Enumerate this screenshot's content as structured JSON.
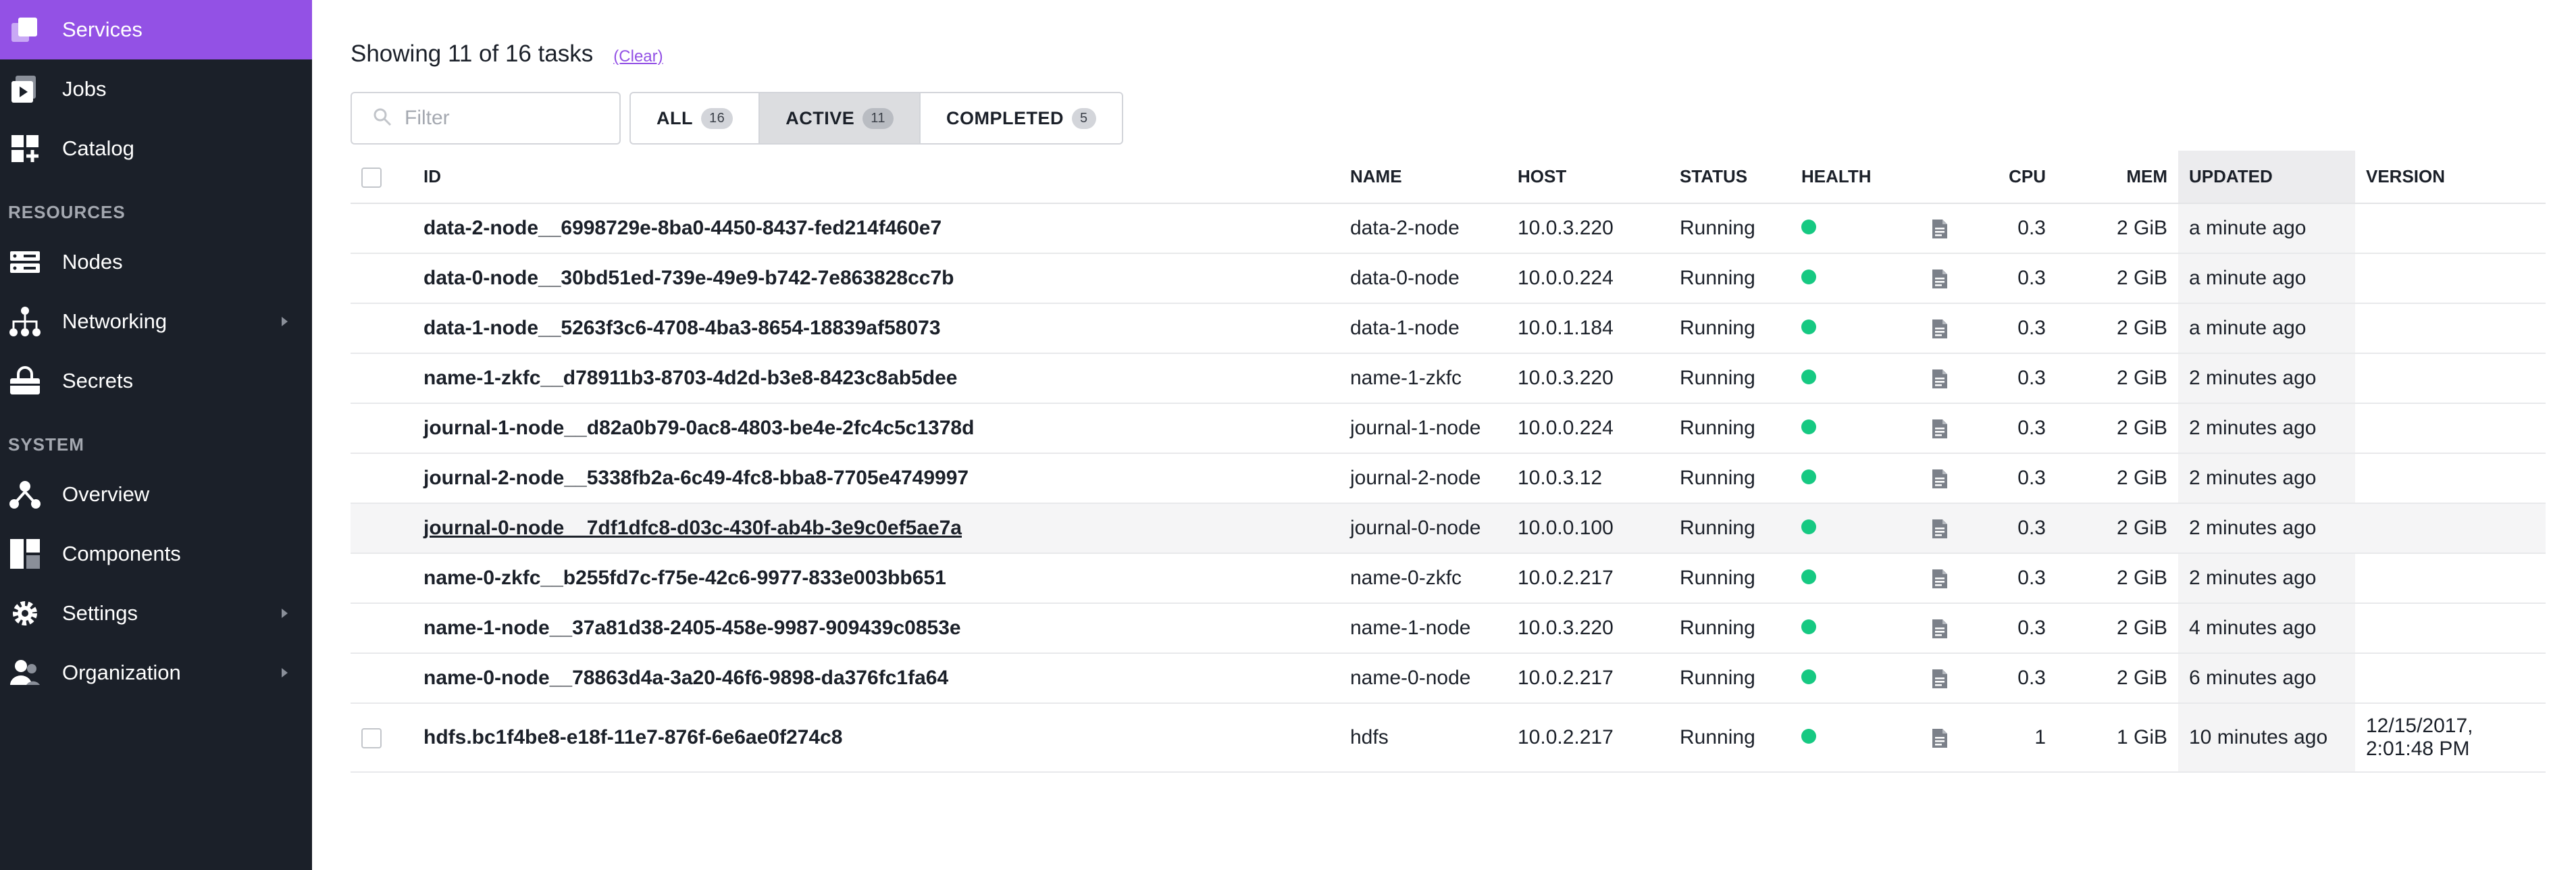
{
  "sidebar": {
    "primary": [
      {
        "label": "Services",
        "icon": "services-icon",
        "active": true
      },
      {
        "label": "Jobs",
        "icon": "jobs-icon"
      },
      {
        "label": "Catalog",
        "icon": "catalog-icon"
      }
    ],
    "resources_label": "RESOURCES",
    "resources": [
      {
        "label": "Nodes",
        "icon": "nodes-icon"
      },
      {
        "label": "Networking",
        "icon": "networking-icon"
      },
      {
        "label": "Secrets",
        "icon": "secrets-icon"
      }
    ],
    "system_label": "SYSTEM",
    "system": [
      {
        "label": "Overview",
        "icon": "overview-icon"
      },
      {
        "label": "Components",
        "icon": "components-icon"
      },
      {
        "label": "Settings",
        "icon": "gear-icon"
      },
      {
        "label": "Organization",
        "icon": "organization-icon"
      }
    ]
  },
  "header": {
    "showing": "Showing 11 of 16 tasks",
    "clear": "(Clear)"
  },
  "filter": {
    "placeholder": "Filter",
    "value": ""
  },
  "tabs": [
    {
      "label": "ALL",
      "count": "16"
    },
    {
      "label": "ACTIVE",
      "count": "11",
      "selected": true
    },
    {
      "label": "COMPLETED",
      "count": "5"
    }
  ],
  "table": {
    "columns": {
      "id": "ID",
      "name": "NAME",
      "host": "HOST",
      "status": "STATUS",
      "health": "HEALTH",
      "cpu": "CPU",
      "mem": "MEM",
      "updated": "UPDATED",
      "version": "VERSION"
    },
    "rows": [
      {
        "id": "data-2-node__6998729e-8ba0-4450-8437-fed214f460e7",
        "name": "data-2-node",
        "host": "10.0.3.220",
        "status": "Running",
        "cpu": "0.3",
        "mem": "2 GiB",
        "updated": "a minute ago",
        "version": ""
      },
      {
        "id": "data-0-node__30bd51ed-739e-49e9-b742-7e863828cc7b",
        "name": "data-0-node",
        "host": "10.0.0.224",
        "status": "Running",
        "cpu": "0.3",
        "mem": "2 GiB",
        "updated": "a minute ago",
        "version": ""
      },
      {
        "id": "data-1-node__5263f3c6-4708-4ba3-8654-18839af58073",
        "name": "data-1-node",
        "host": "10.0.1.184",
        "status": "Running",
        "cpu": "0.3",
        "mem": "2 GiB",
        "updated": "a minute ago",
        "version": ""
      },
      {
        "id": "name-1-zkfc__d78911b3-8703-4d2d-b3e8-8423c8ab5dee",
        "name": "name-1-zkfc",
        "host": "10.0.3.220",
        "status": "Running",
        "cpu": "0.3",
        "mem": "2 GiB",
        "updated": "2 minutes ago",
        "version": ""
      },
      {
        "id": "journal-1-node__d82a0b79-0ac8-4803-be4e-2fc4c5c1378d",
        "name": "journal-1-node",
        "host": "10.0.0.224",
        "status": "Running",
        "cpu": "0.3",
        "mem": "2 GiB",
        "updated": "2 minutes ago",
        "version": ""
      },
      {
        "id": "journal-2-node__5338fb2a-6c49-4fc8-bba8-7705e4749997",
        "name": "journal-2-node",
        "host": "10.0.3.12",
        "status": "Running",
        "cpu": "0.3",
        "mem": "2 GiB",
        "updated": "2 minutes ago",
        "version": ""
      },
      {
        "id": "journal-0-node__7df1dfc8-d03c-430f-ab4b-3e9c0ef5ae7a",
        "name": "journal-0-node",
        "host": "10.0.0.100",
        "status": "Running",
        "cpu": "0.3",
        "mem": "2 GiB",
        "updated": "2 minutes ago",
        "version": ""
      },
      {
        "id": "name-0-zkfc__b255fd7c-f75e-42c6-9977-833e003bb651",
        "name": "name-0-zkfc",
        "host": "10.0.2.217",
        "status": "Running",
        "cpu": "0.3",
        "mem": "2 GiB",
        "updated": "2 minutes ago",
        "version": ""
      },
      {
        "id": "name-1-node__37a81d38-2405-458e-9987-909439c0853e",
        "name": "name-1-node",
        "host": "10.0.3.220",
        "status": "Running",
        "cpu": "0.3",
        "mem": "2 GiB",
        "updated": "4 minutes ago",
        "version": ""
      },
      {
        "id": "name-0-node__78863d4a-3a20-46f6-9898-da376fc1fa64",
        "name": "name-0-node",
        "host": "10.0.2.217",
        "status": "Running",
        "cpu": "0.3",
        "mem": "2 GiB",
        "updated": "6 minutes ago",
        "version": ""
      },
      {
        "id": "hdfs.bc1f4be8-e18f-11e7-876f-6e6ae0f274c8",
        "name": "hdfs",
        "host": "10.0.2.217",
        "status": "Running",
        "cpu": "1",
        "mem": "1 GiB",
        "updated": "10 minutes ago",
        "version": "12/15/2017, 2:01:48 PM"
      }
    ]
  },
  "colors": {
    "accent": "#9351e5",
    "sidebar_bg": "#1b2029",
    "health_ok": "#16c982"
  }
}
